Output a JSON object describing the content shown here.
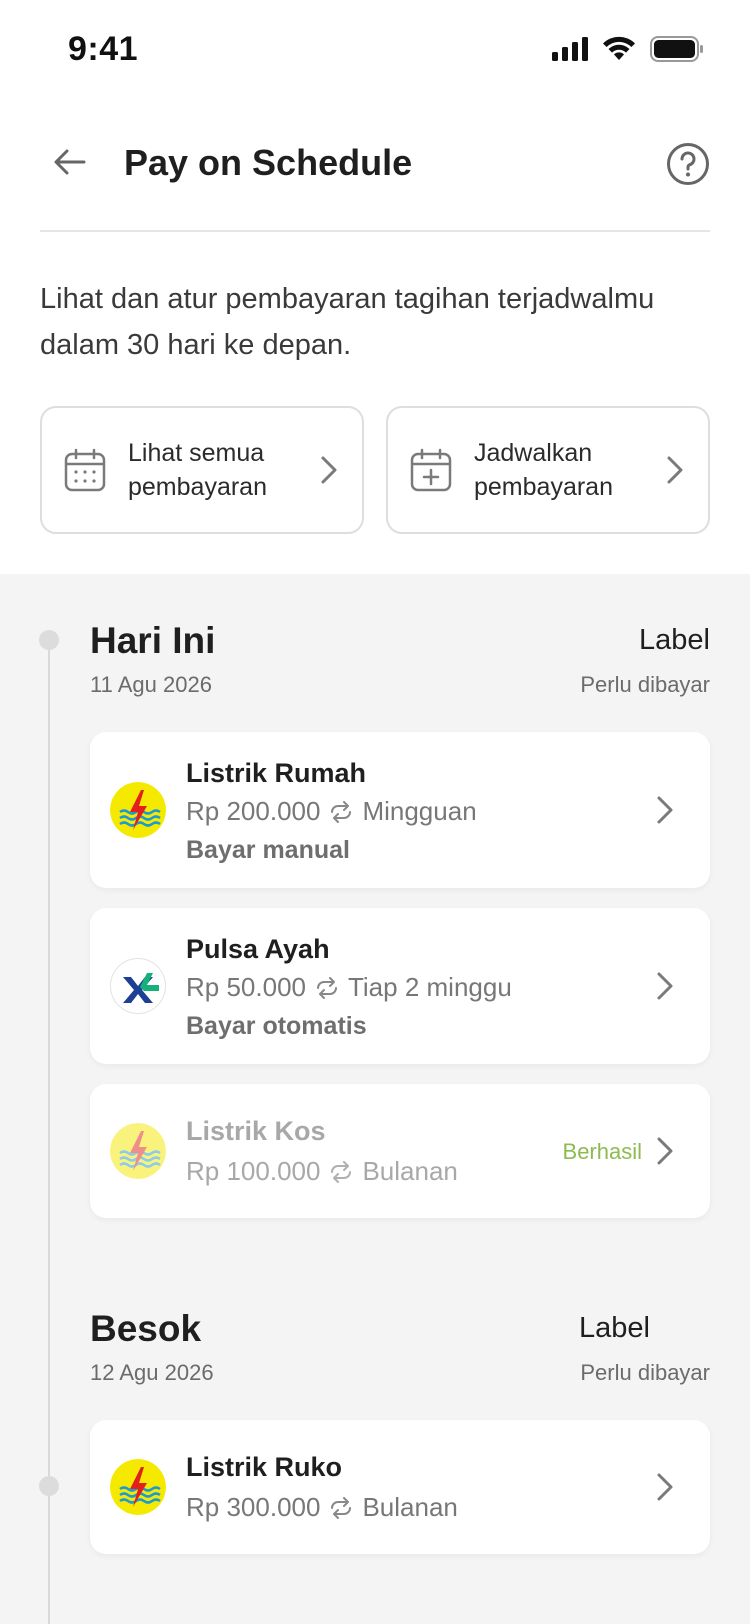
{
  "status_bar": {
    "time": "9:41"
  },
  "header": {
    "title": "Pay on Schedule"
  },
  "intro": "Lihat dan atur pembayaran tagihan terjadwalmu dalam 30 hari ke depan.",
  "actions": [
    {
      "label": "Lihat semua pembayaran",
      "icon": "calendar-icon"
    },
    {
      "label": "Jadwalkan pembayaran",
      "icon": "calendar-add-icon"
    }
  ],
  "sections": [
    {
      "title": "Hari Ini",
      "date": "11 Agu 2026",
      "label": "Label",
      "status": "Perlu dibayar",
      "bills": [
        {
          "name": "Listrik Rumah",
          "amount": "Rp 200.000",
          "frequency": "Mingguan",
          "mode": "Bayar manual",
          "logo": "pln-logo"
        },
        {
          "name": "Pulsa Ayah",
          "amount": "Rp 50.000",
          "frequency": "Tiap 2 minggu",
          "mode": "Bayar otomatis",
          "logo": "xl-logo"
        },
        {
          "name": "Listrik Kos",
          "amount": "Rp 100.000",
          "frequency": "Bulanan",
          "status": "Berhasil",
          "logo": "pln-logo"
        }
      ]
    },
    {
      "title": "Besok",
      "date": "12 Agu 2026",
      "label": "Label",
      "status": "Perlu dibayar",
      "bills": [
        {
          "name": "Listrik Ruko",
          "amount": "Rp 300.000",
          "frequency": "Bulanan",
          "logo": "pln-logo"
        }
      ]
    }
  ],
  "colors": {
    "success": "#8dbb4f",
    "pln_yellow": "#f5e900",
    "pln_red": "#e3201b",
    "pln_blue": "#1a9ad7",
    "xl_blue": "#1d3f94",
    "xl_green": "#16b07a"
  }
}
